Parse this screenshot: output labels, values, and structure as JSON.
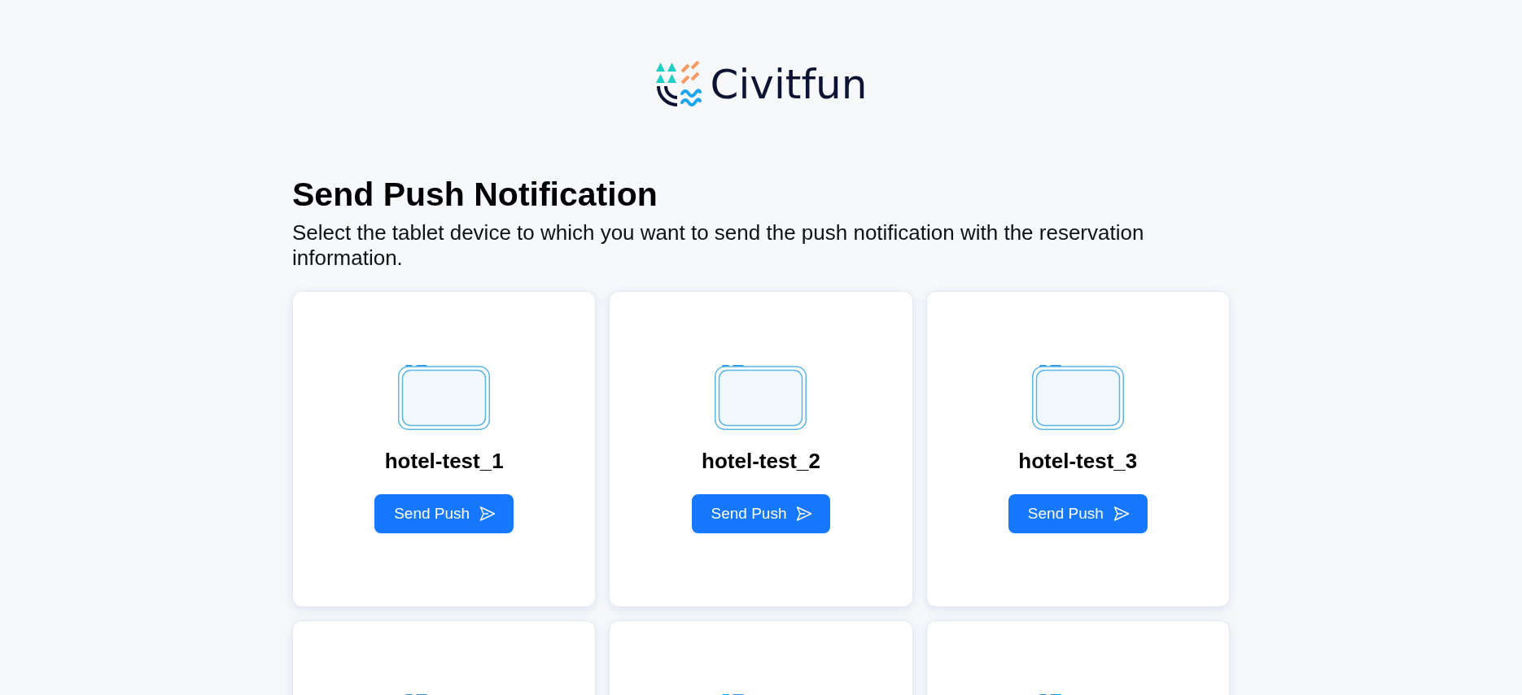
{
  "logo": {
    "text": "Civitfun"
  },
  "header": {
    "title": "Send Push Notification",
    "description": "Select the tablet device to which you want to send the push notification with the reservation information."
  },
  "devices": [
    {
      "kind": "tablet",
      "name": "hotel-test_1",
      "action": "Send Push"
    },
    {
      "kind": "tablet",
      "name": "hotel-test_2",
      "action": "Send Push"
    },
    {
      "kind": "tablet",
      "name": "hotel-test_3",
      "action": "Send Push"
    },
    {
      "kind": "tablet"
    },
    {
      "kind": "tablet"
    },
    {
      "kind": "tablet"
    }
  ]
}
